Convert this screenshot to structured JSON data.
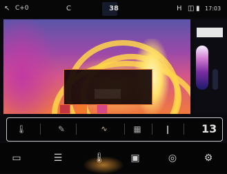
{
  "status_bar": {
    "back_glyph": "↖",
    "mode": "C+0",
    "camera_glyph": "C",
    "center_value": "38",
    "right_icon1": "H",
    "right_icon2": "◫",
    "battery_glyph": "▮",
    "time": "17:03"
  },
  "dialog": {
    "message": "",
    "button_label": ""
  },
  "side_panel": {
    "label": ""
  },
  "control_strip": {
    "temp_glyph": "🌡",
    "pen_glyph": "✎",
    "wave_glyph": "∿",
    "hd_glyph": "▦",
    "bar_glyph": "❙",
    "number": "13"
  },
  "bottom_bar": {
    "icons": [
      "gallery-icon",
      "list-icon",
      "thermometer-icon",
      "image-icon",
      "camera-icon",
      "settings-icon"
    ]
  },
  "colors": {
    "accent": "#e06b2b",
    "strip_border": "#cbcbcb"
  }
}
